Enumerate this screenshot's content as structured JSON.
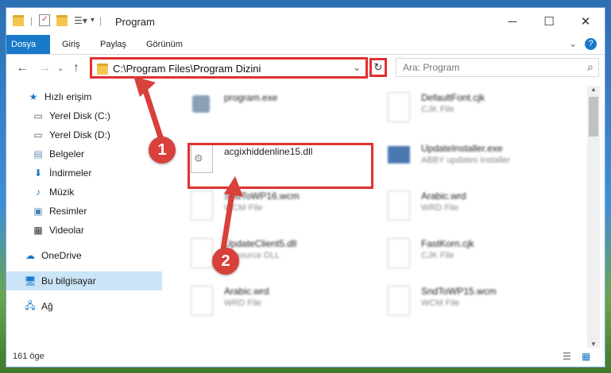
{
  "window": {
    "title": "Program"
  },
  "ribbon": {
    "tabs": [
      "Dosya",
      "Giriş",
      "Paylaş",
      "Görünüm"
    ]
  },
  "address": {
    "path": "C:\\Program Files\\Program Dizini"
  },
  "search": {
    "placeholder": "Ara: Program"
  },
  "sidebar": {
    "quick_access": "Hızlı erişim",
    "items": [
      {
        "label": "Yerel Disk (C:)",
        "icon": "drive-icon",
        "pinned": true
      },
      {
        "label": "Yerel Disk (D:)",
        "icon": "drive-icon",
        "pinned": true
      },
      {
        "label": "Belgeler",
        "icon": "documents-icon",
        "pinned": true
      },
      {
        "label": "İndirmeler",
        "icon": "download-icon",
        "pinned": true
      },
      {
        "label": "Müzik",
        "icon": "music-icon",
        "pinned": true
      },
      {
        "label": "Resimler",
        "icon": "pictures-icon",
        "pinned": true
      },
      {
        "label": "Videolar",
        "icon": "videos-icon",
        "pinned": true
      }
    ],
    "onedrive": "OneDrive",
    "this_pc": "Bu bilgisayar",
    "network": "Ağ"
  },
  "files": [
    {
      "name": "program.exe",
      "desc": ""
    },
    {
      "name": "DefaultFont.cjk",
      "desc": "CJK File"
    },
    {
      "name": "acgixhiddenline15.dll",
      "desc": ""
    },
    {
      "name": "UpdateInstaller.exe",
      "desc": "ABBY updates installer"
    },
    {
      "name": "SndToWP16.wcm",
      "desc": "WCM File"
    },
    {
      "name": "Arabic.wrd",
      "desc": "WRD File"
    },
    {
      "name": "UpdateClient5.dll",
      "desc": "Resource DLL"
    },
    {
      "name": "FastKorn.cjk",
      "desc": "CJK File"
    },
    {
      "name": "Arabic.wrd",
      "desc": "WRD File"
    },
    {
      "name": "SndToWP15.wcm",
      "desc": "WCM File"
    }
  ],
  "status": {
    "count": "161 öge"
  },
  "annotations": {
    "badge1": "1",
    "badge2": "2"
  },
  "colors": {
    "accent": "#1979ca",
    "highlight": "#e03030"
  }
}
